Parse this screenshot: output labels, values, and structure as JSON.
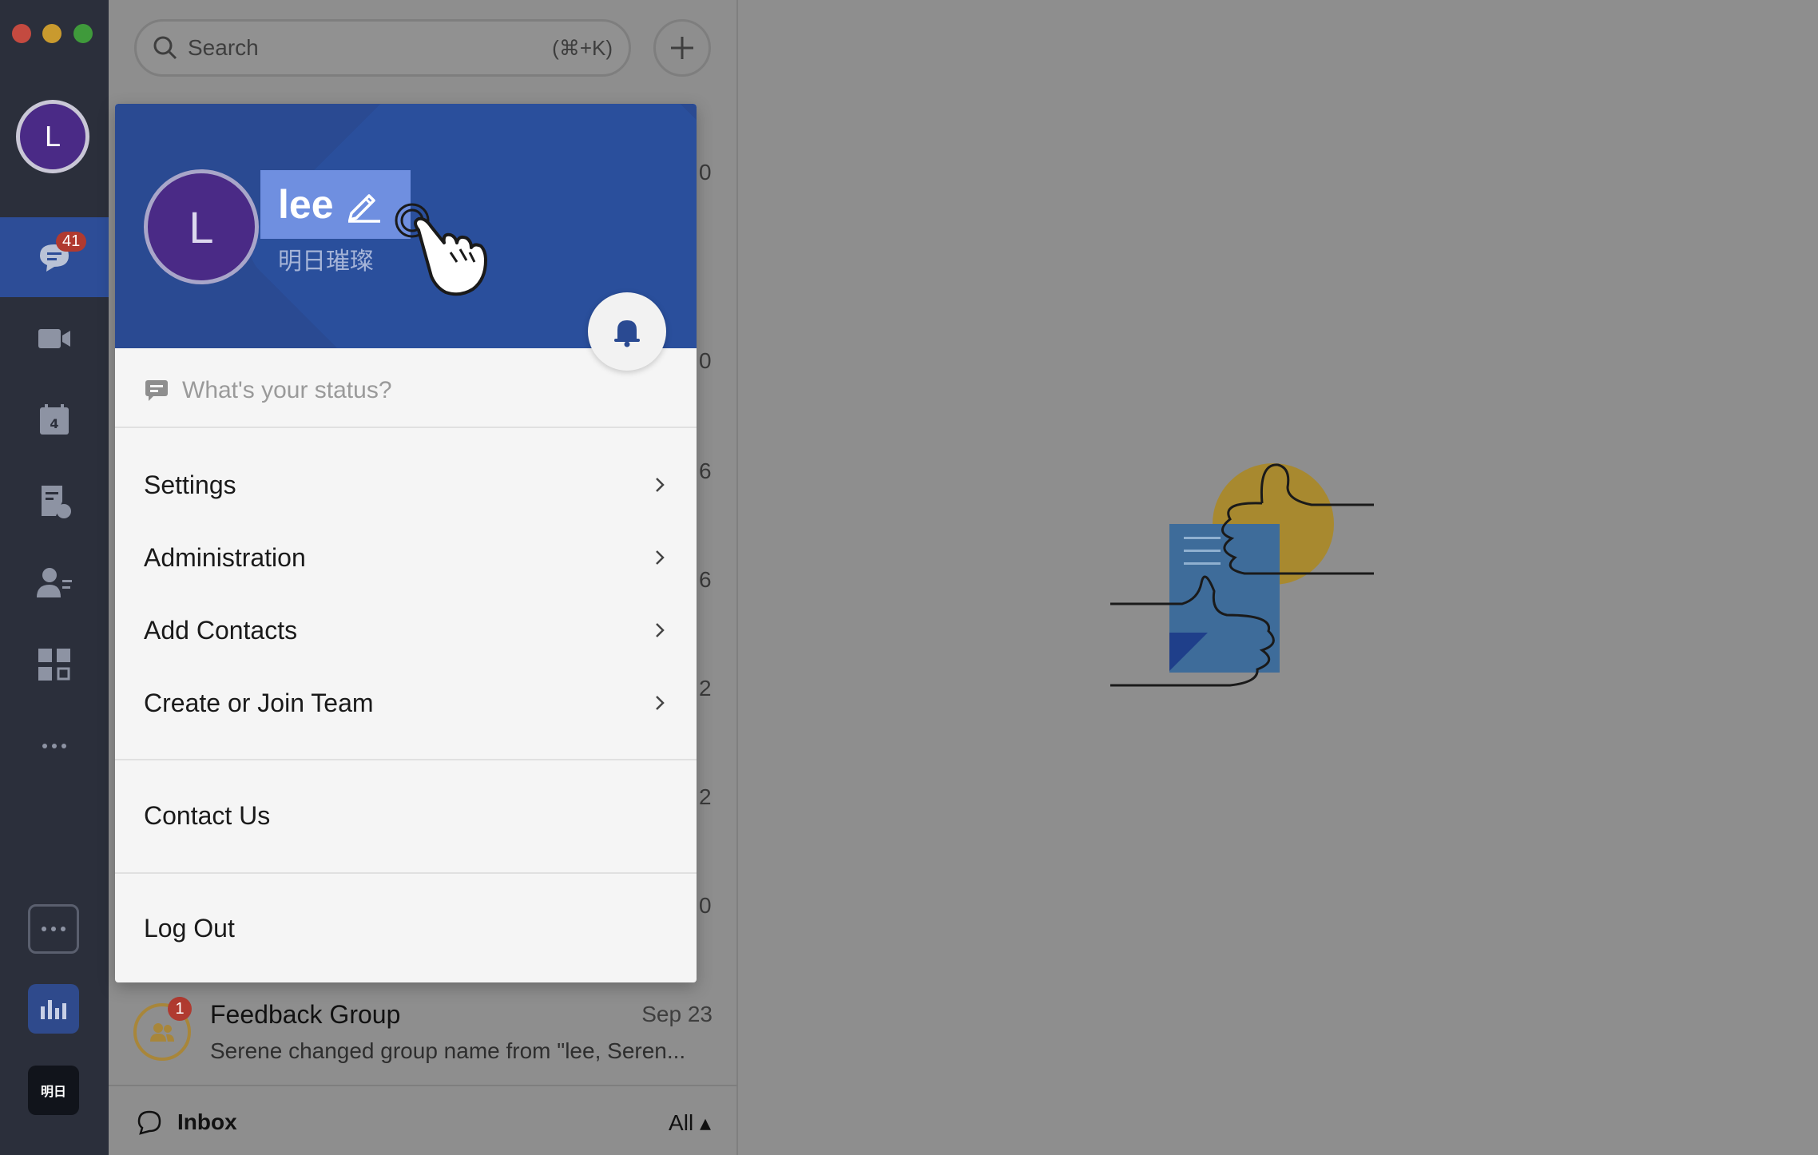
{
  "rail": {
    "avatar_initial": "L",
    "chat_badge": "41",
    "bottom_label": "明日"
  },
  "search": {
    "placeholder": "Search",
    "shortcut": "(⌘+K)"
  },
  "edge_numbers": [
    "0",
    "0",
    "6",
    "6",
    "2",
    "2",
    "0"
  ],
  "profile": {
    "initial": "L",
    "name": "lee",
    "subname": "明日璀璨"
  },
  "status_placeholder": "What's your status?",
  "menu": {
    "settings": "Settings",
    "administration": "Administration",
    "add_contacts": "Add Contacts",
    "create_join_team": "Create or Join Team",
    "contact_us": "Contact Us",
    "log_out": "Log Out"
  },
  "conversation": {
    "name": "Feedback Group",
    "date": "Sep 23",
    "preview": "Serene changed group name from \"lee, Seren...",
    "badge": "1"
  },
  "inbox": {
    "label": "Inbox",
    "filter": "All ▴"
  },
  "colors": {
    "rail_bg": "#2b2f3b",
    "rail_active": "#2d4d97",
    "header_blue": "#2a4a92",
    "badge_red": "#b03a30"
  }
}
